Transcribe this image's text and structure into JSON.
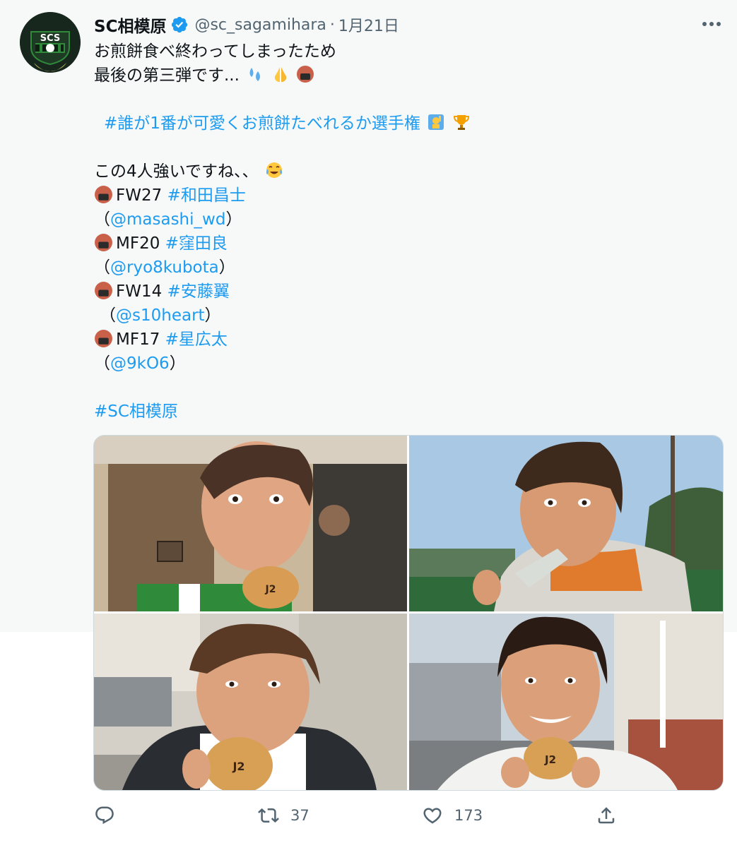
{
  "account": {
    "name": "SC相模原",
    "handle": "@sc_sagamihara",
    "separator": "·",
    "date": "1月21日",
    "avatar_text": "SCS"
  },
  "tweet": {
    "line1": "お煎餅食べ終わってしまったため",
    "line2": "最後の第三弾です...",
    "hashtag_main": "#誰が1番が可愛くお煎餅たべれるか選手権",
    "intro": "この4人強いですね、、",
    "players": [
      {
        "position": "FW27",
        "tag": "#和田昌士",
        "mention": "@masashi_wd"
      },
      {
        "position": "MF20",
        "tag": "#窪田良",
        "mention": "@ryo8kubota"
      },
      {
        "position": "FW14",
        "tag": "#安藤翼",
        "mention": "@s10heart"
      },
      {
        "position": "MF17",
        "tag": "#星広太",
        "mention": "@9kO6"
      }
    ],
    "paren_open": "（",
    "paren_close": "）",
    "footer_tag": "#SC相模原"
  },
  "photos": [
    {
      "alt": "player-1-eating-senbei"
    },
    {
      "alt": "player-2-eating-senbei"
    },
    {
      "alt": "player-3-eating-senbei"
    },
    {
      "alt": "player-4-eating-senbei"
    }
  ],
  "actions": {
    "reply_icon": "reply-icon",
    "retweet_icon": "retweet-icon",
    "retweet_count": "37",
    "like_icon": "heart-icon",
    "like_count": "173",
    "share_icon": "share-icon"
  },
  "colors": {
    "link": "#1d9bf0",
    "secondary": "#536471",
    "verified": "#1d9bf0",
    "panel_bg": "#f7f9f9"
  }
}
